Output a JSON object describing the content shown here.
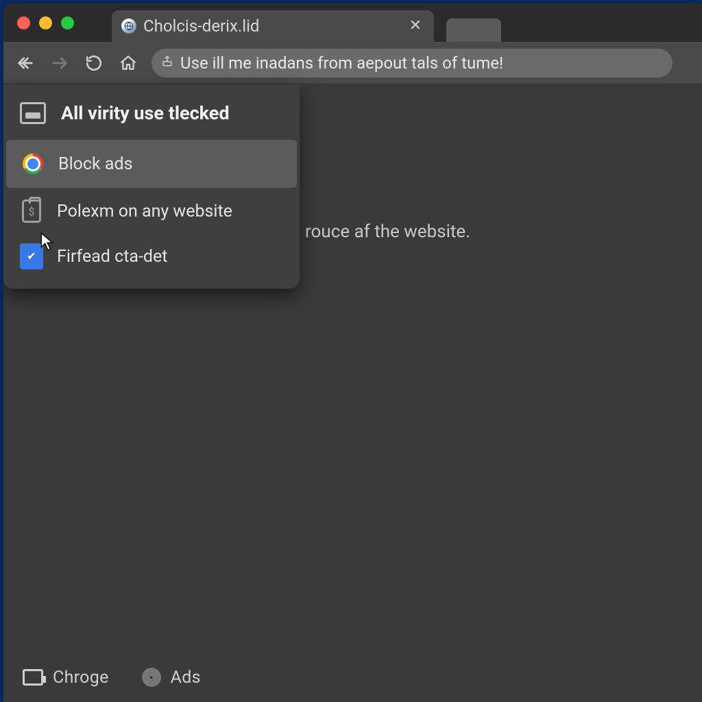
{
  "tab": {
    "title": "Cholcis-derix.lid"
  },
  "omnibox": {
    "text": "Use ill me inadans from aepout tals of   tume!"
  },
  "dropdown": {
    "header": "All virity use tlecked",
    "items": [
      {
        "label": "Block ads"
      },
      {
        "label": "Polexm on any website"
      },
      {
        "label": "Firfead cta-det"
      }
    ]
  },
  "content": {
    "partial_text": "rouce af the website."
  },
  "bottom": {
    "item1": "Chroge",
    "item2": "Ads"
  }
}
